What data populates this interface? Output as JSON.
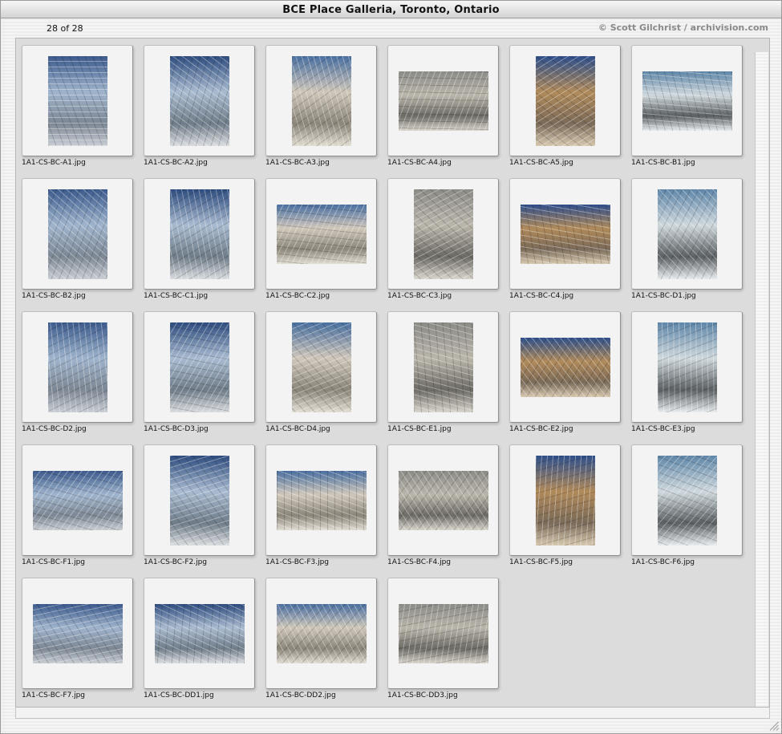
{
  "window": {
    "title": "BCE Place Galleria, Toronto, Ontario"
  },
  "header": {
    "count": "28 of 28",
    "credit": "© Scott Gilchrist / archivision.com"
  },
  "thumbnails": [
    {
      "label": "1A1-CS-BC-A1.jpg",
      "orientation": "portrait"
    },
    {
      "label": "1A1-CS-BC-A2.jpg",
      "orientation": "portrait"
    },
    {
      "label": "1A1-CS-BC-A3.jpg",
      "orientation": "portrait"
    },
    {
      "label": "1A1-CS-BC-A4.jpg",
      "orientation": "landscape"
    },
    {
      "label": "1A1-CS-BC-A5.jpg",
      "orientation": "portrait"
    },
    {
      "label": "1A1-CS-BC-B1.jpg",
      "orientation": "landscape"
    },
    {
      "label": "1A1-CS-BC-B2.jpg",
      "orientation": "portrait"
    },
    {
      "label": "1A1-CS-BC-C1.jpg",
      "orientation": "portrait"
    },
    {
      "label": "1A1-CS-BC-C2.jpg",
      "orientation": "landscape"
    },
    {
      "label": "1A1-CS-BC-C3.jpg",
      "orientation": "portrait"
    },
    {
      "label": "1A1-CS-BC-C4.jpg",
      "orientation": "landscape"
    },
    {
      "label": "1A1-CS-BC-D1.jpg",
      "orientation": "portrait"
    },
    {
      "label": "1A1-CS-BC-D2.jpg",
      "orientation": "portrait"
    },
    {
      "label": "1A1-CS-BC-D3.jpg",
      "orientation": "portrait"
    },
    {
      "label": "1A1-CS-BC-D4.jpg",
      "orientation": "portrait"
    },
    {
      "label": "1A1-CS-BC-E1.jpg",
      "orientation": "portrait"
    },
    {
      "label": "1A1-CS-BC-E2.jpg",
      "orientation": "landscape"
    },
    {
      "label": "1A1-CS-BC-E3.jpg",
      "orientation": "portrait"
    },
    {
      "label": "1A1-CS-BC-F1.jpg",
      "orientation": "landscape"
    },
    {
      "label": "1A1-CS-BC-F2.jpg",
      "orientation": "portrait"
    },
    {
      "label": "1A1-CS-BC-F3.jpg",
      "orientation": "landscape"
    },
    {
      "label": "1A1-CS-BC-F4.jpg",
      "orientation": "landscape"
    },
    {
      "label": "1A1-CS-BC-F5.jpg",
      "orientation": "portrait"
    },
    {
      "label": "1A1-CS-BC-F6.jpg",
      "orientation": "portrait"
    },
    {
      "label": "1A1-CS-BC-F7.jpg",
      "orientation": "landscape"
    },
    {
      "label": "1A1-CS-BC-DD1.jpg",
      "orientation": "landscape"
    },
    {
      "label": "1A1-CS-BC-DD2.jpg",
      "orientation": "landscape"
    },
    {
      "label": "1A1-CS-BC-DD3.jpg",
      "orientation": "landscape"
    }
  ]
}
